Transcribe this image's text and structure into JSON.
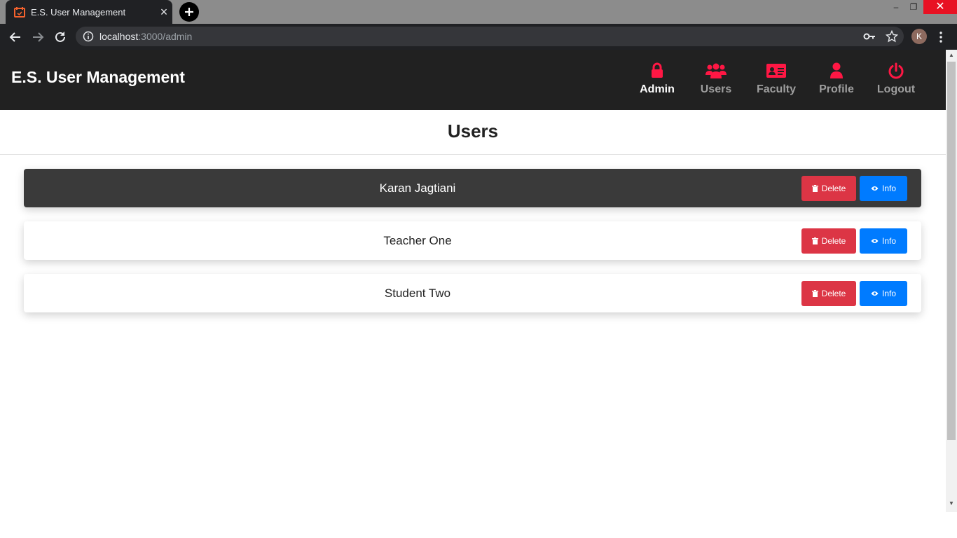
{
  "browser": {
    "tab_title": "E.S. User Management",
    "url_host": "localhost",
    "url_path": ":3000/admin",
    "profile_initial": "K"
  },
  "app": {
    "brand": "E.S. User Management",
    "nav": [
      {
        "label": "Admin",
        "icon": "lock-icon",
        "active": true
      },
      {
        "label": "Users",
        "icon": "users-icon",
        "active": false
      },
      {
        "label": "Faculty",
        "icon": "id-card-icon",
        "active": false
      },
      {
        "label": "Profile",
        "icon": "user-icon",
        "active": false
      },
      {
        "label": "Logout",
        "icon": "power-icon",
        "active": false
      }
    ],
    "accent_color": "#ff1744"
  },
  "page": {
    "title": "Users",
    "users": [
      {
        "name": "Karan Jagtiani",
        "selected": true
      },
      {
        "name": "Teacher One",
        "selected": false
      },
      {
        "name": "Student Two",
        "selected": false
      }
    ],
    "delete_label": "Delete",
    "info_label": "Info",
    "delete_color": "#dc3545",
    "info_color": "#007bff"
  }
}
